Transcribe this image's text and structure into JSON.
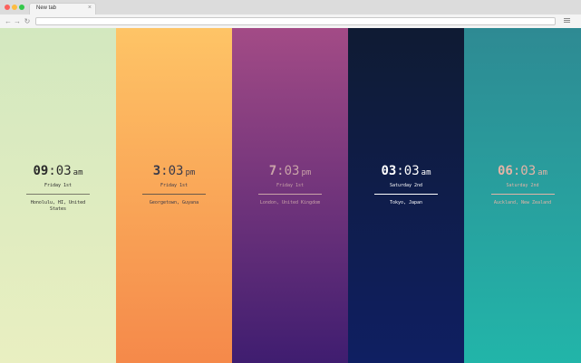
{
  "browser": {
    "tab_title": "New tab",
    "tab_close": "×",
    "url": "",
    "nav_back": "←",
    "nav_forward": "→",
    "nav_reload": "↻"
  },
  "clocks": [
    {
      "hour": "09",
      "colon": ":",
      "minute": "03",
      "ampm": "am",
      "date": "Friday 1st",
      "location": "Honolulu, HI, United States",
      "text_color": "#2b2b2b",
      "rule_color": "#7a7a6a"
    },
    {
      "hour": "3",
      "colon": ":",
      "minute": "03",
      "ampm": "pm",
      "date": "Friday 1st",
      "location": "Georgetown, Guyana",
      "text_color": "#3a3a4a",
      "rule_color": "#6a5a4a"
    },
    {
      "hour": "7",
      "colon": ":",
      "minute": "03",
      "ampm": "pm",
      "date": "Friday 1st",
      "location": "London, United Kingdom",
      "text_color": "#c9a3a8",
      "rule_color": "#c9a3a8"
    },
    {
      "hour": "03",
      "colon": ":",
      "minute": "03",
      "ampm": "am",
      "date": "Saturday 2nd",
      "location": "Tokyo, Japan",
      "text_color": "#ffffff",
      "rule_color": "#ffffff"
    },
    {
      "hour": "06",
      "colon": ":",
      "minute": "03",
      "ampm": "am",
      "date": "Saturday 2nd",
      "location": "Auckland, New Zealand",
      "text_color": "#e4b3a6",
      "rule_color": "#e4b3a6"
    }
  ]
}
